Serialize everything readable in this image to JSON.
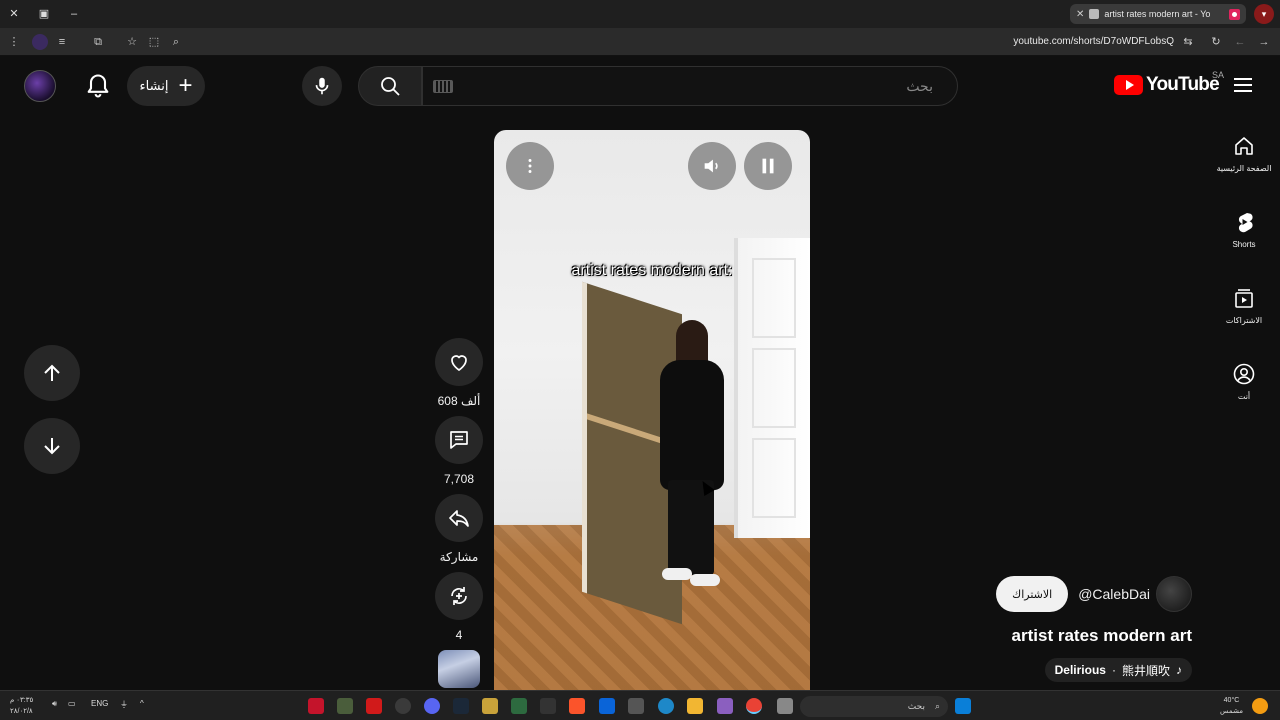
{
  "browser": {
    "tab_title": "artist rates modern art - Yo",
    "url": "youtube.com/shorts/D7oWDFLobsQ",
    "new_tab_icon": "plus-icon",
    "close_icon": "close-icon"
  },
  "header": {
    "logo_text": "YouTube",
    "country_code": "SA",
    "search_placeholder": "بحث",
    "create_label": "إنشاء"
  },
  "guide": {
    "items": [
      {
        "label": "الصفحة الرئيسية",
        "icon": "home-icon"
      },
      {
        "label": "Shorts",
        "icon": "shorts-icon"
      },
      {
        "label": "الاشتراكات",
        "icon": "subscriptions-icon"
      },
      {
        "label": "أنت",
        "icon": "you-icon"
      }
    ]
  },
  "video": {
    "caption": "artist rates modern art:"
  },
  "actions": {
    "likes": "608 ألف",
    "comments": "7,708",
    "share": "مشاركة",
    "remix": "4"
  },
  "channel": {
    "handle": "@CalebDai",
    "subscribe_label": "الاشتراك"
  },
  "short": {
    "title": "artist rates modern art",
    "music_artist": "Delirious",
    "music_track": "熊井順吹"
  },
  "taskbar": {
    "search_label": "بحث",
    "language": "ENG",
    "weather_temp": "40°C",
    "weather_desc": "مشمس",
    "time": "٠٣:٣٥ م",
    "date": "٢٨/٠٢/٨"
  },
  "colors": {
    "background": "#0f0f0f",
    "brand_red": "#ff0000",
    "button_bg": "#272727"
  }
}
